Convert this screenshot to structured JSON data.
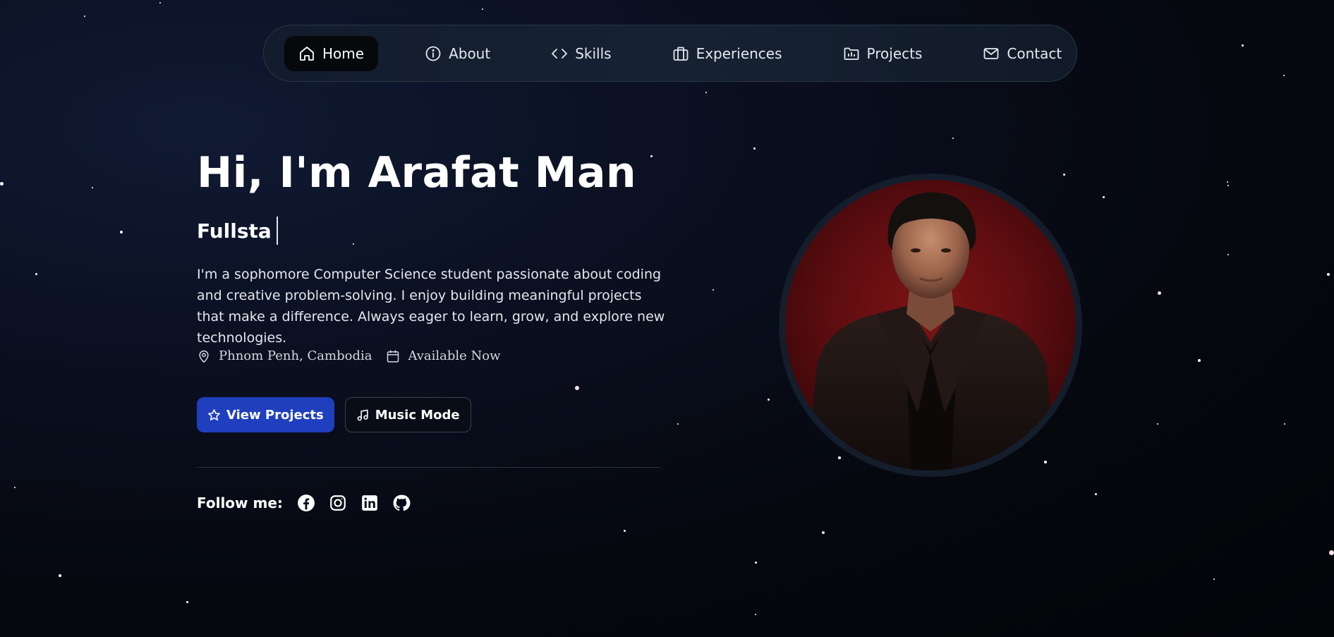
{
  "nav": {
    "items": [
      {
        "label": "Home",
        "icon": "home-icon",
        "active": true
      },
      {
        "label": "About",
        "icon": "info-icon",
        "active": false
      },
      {
        "label": "Skills",
        "icon": "code-icon",
        "active": false
      },
      {
        "label": "Experiences",
        "icon": "briefcase-icon",
        "active": false
      },
      {
        "label": "Projects",
        "icon": "folder-icon",
        "active": false
      },
      {
        "label": "Contact",
        "icon": "mail-icon",
        "active": false
      }
    ]
  },
  "hero": {
    "title": "Hi, I'm Arafat Man",
    "typing_text": "Fullsta",
    "description": "I'm a sophomore Computer Science student passionate about coding and creative problem-solving. I enjoy building meaningful projects that make a difference. Always eager to learn, grow, and explore new technologies.",
    "location": "Phnom Penh, Cambodia",
    "availability": "Available Now",
    "primary_button": "View Projects",
    "secondary_button": "Music Mode",
    "follow_label": "Follow me:",
    "socials": [
      "facebook-icon",
      "instagram-icon",
      "linkedin-icon",
      "github-icon"
    ]
  },
  "colors": {
    "primary_button": "#1f3fbf",
    "portrait_background": "#6b0f12",
    "nav_background": "#141e2e"
  }
}
